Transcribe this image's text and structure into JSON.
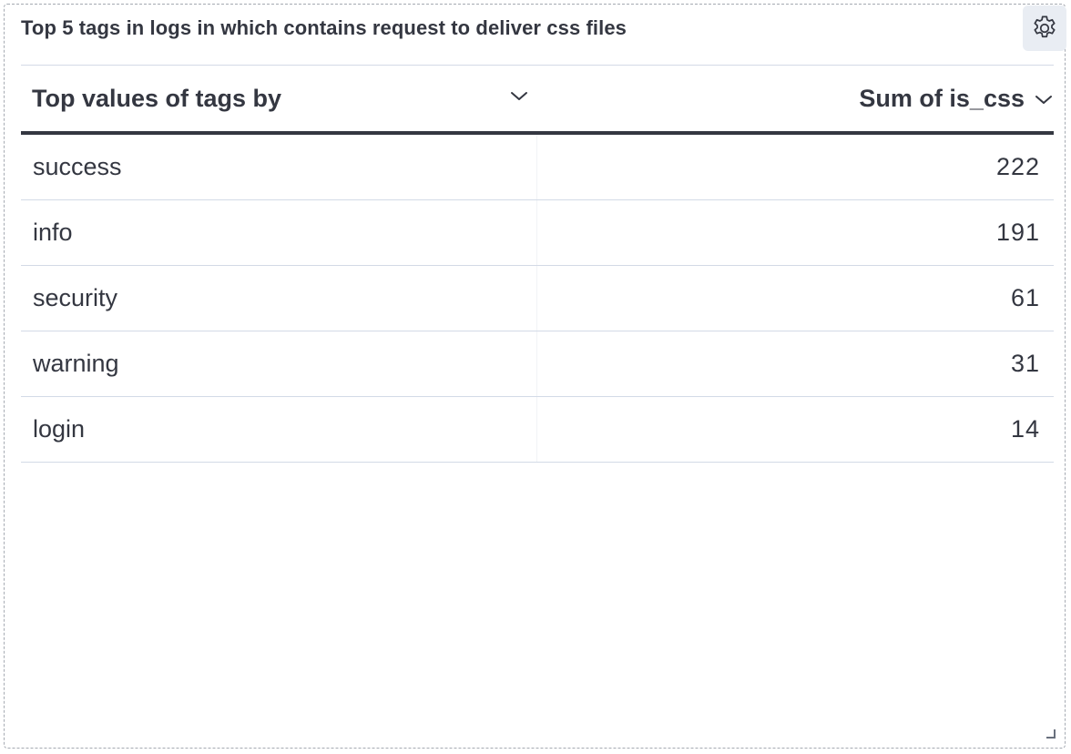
{
  "panel": {
    "title": "Top 5 tags in logs in which contains request to deliver css files",
    "options_icon": "gear-icon"
  },
  "table": {
    "columns": [
      {
        "label": "Top values of tags by",
        "menu_icon": "chevron-down-icon"
      },
      {
        "label": "Sum of is_css",
        "menu_icon": "chevron-down-icon"
      }
    ],
    "rows": [
      {
        "tag": "success",
        "value": "222"
      },
      {
        "tag": "info",
        "value": "191"
      },
      {
        "tag": "security",
        "value": "61"
      },
      {
        "tag": "warning",
        "value": "31"
      },
      {
        "tag": "login",
        "value": "14"
      }
    ]
  },
  "colors": {
    "text": "#343741",
    "border": "#d3dae6",
    "header_rule": "#343741",
    "options_bg": "#e9edf3"
  },
  "resize_icon": "resize-handle-icon"
}
